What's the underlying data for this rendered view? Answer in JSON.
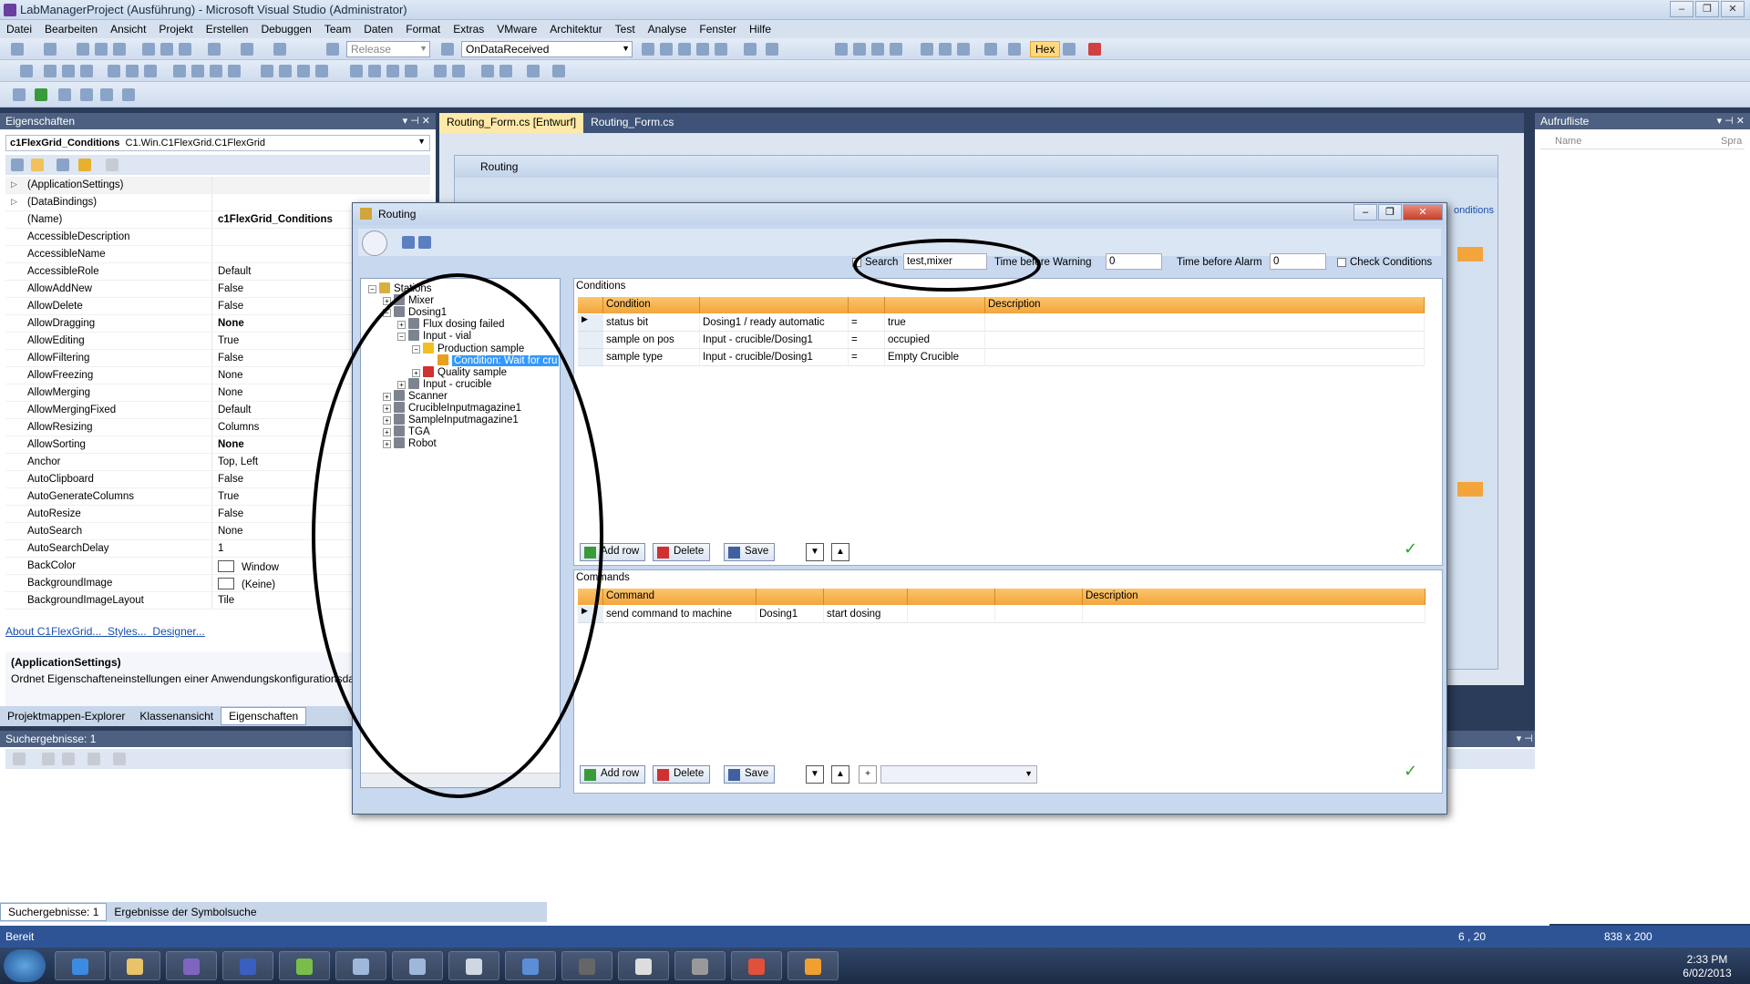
{
  "window": {
    "title": "LabManagerProject (Ausführung) - Microsoft Visual Studio (Administrator)"
  },
  "menu": [
    "Datei",
    "Bearbeiten",
    "Ansicht",
    "Projekt",
    "Erstellen",
    "Debuggen",
    "Team",
    "Daten",
    "Format",
    "Extras",
    "VMware",
    "Architektur",
    "Test",
    "Analyse",
    "Fenster",
    "Hilfe"
  ],
  "toolbar": {
    "config": "Release",
    "method": "OnDataReceived",
    "hex": "Hex"
  },
  "properties": {
    "title": "Eigenschaften",
    "object": "c1FlexGrid_Conditions",
    "type": "C1.Win.C1FlexGrid.C1FlexGrid",
    "rows": [
      {
        "name": "(ApplicationSettings)",
        "value": "",
        "expand": "▷"
      },
      {
        "name": "(DataBindings)",
        "value": "",
        "expand": "▷"
      },
      {
        "name": "(Name)",
        "value": "c1FlexGrid_Conditions",
        "bold": true
      },
      {
        "name": "AccessibleDescription",
        "value": ""
      },
      {
        "name": "AccessibleName",
        "value": ""
      },
      {
        "name": "AccessibleRole",
        "value": "Default"
      },
      {
        "name": "AllowAddNew",
        "value": "False"
      },
      {
        "name": "AllowDelete",
        "value": "False"
      },
      {
        "name": "AllowDragging",
        "value": "None",
        "bold": true
      },
      {
        "name": "AllowEditing",
        "value": "True"
      },
      {
        "name": "AllowFiltering",
        "value": "False"
      },
      {
        "name": "AllowFreezing",
        "value": "None"
      },
      {
        "name": "AllowMerging",
        "value": "None"
      },
      {
        "name": "AllowMergingFixed",
        "value": "Default"
      },
      {
        "name": "AllowResizing",
        "value": "Columns"
      },
      {
        "name": "AllowSorting",
        "value": "None",
        "bold": true
      },
      {
        "name": "Anchor",
        "value": "Top, Left"
      },
      {
        "name": "AutoClipboard",
        "value": "False"
      },
      {
        "name": "AutoGenerateColumns",
        "value": "True"
      },
      {
        "name": "AutoResize",
        "value": "False"
      },
      {
        "name": "AutoSearch",
        "value": "None"
      },
      {
        "name": "AutoSearchDelay",
        "value": "1"
      },
      {
        "name": "BackColor",
        "value": "Window",
        "swatch": true
      },
      {
        "name": "BackgroundImage",
        "value": "(Keine)",
        "swatch": true
      },
      {
        "name": "BackgroundImageLayout",
        "value": "Tile"
      }
    ],
    "links": [
      "About C1FlexGrid...",
      "Styles...",
      "Designer..."
    ],
    "desc_title": "(ApplicationSettings)",
    "desc_text": "Ordnet Eigenschafteneinstellungen einer Anwendungskonfigurationsdatei zu."
  },
  "left_tabs": [
    "Projektmappen-Explorer",
    "Klassenansicht",
    "Eigenschaften"
  ],
  "search": {
    "title": "Suchergebnisse: 1",
    "tabs": [
      "Suchergebnisse: 1",
      "Ergebnisse der Symbolsuche"
    ]
  },
  "doctabs": [
    "Routing_Form.cs [Entwurf]",
    "Routing_Form.cs"
  ],
  "aufruf": {
    "title": "Aufrufliste",
    "col1": "Name",
    "col2": "Spra"
  },
  "bgform": {
    "title": "Routing",
    "partial": "onditions"
  },
  "status": {
    "left": "Bereit",
    "pos": "6 , 20",
    "size": "838 x 200"
  },
  "clock": {
    "time": "2:33 PM",
    "date": "6/02/2013"
  },
  "routing": {
    "title": "Routing",
    "filter": {
      "search_label": "Search",
      "search_value": "test,mixer",
      "warning_label": "Time before Warning",
      "warning_value": "0",
      "alarm_label": "Time before Alarm",
      "alarm_value": "0",
      "check_label": "Check Conditions"
    },
    "tree": [
      {
        "label": "Stations",
        "level": 0
      },
      {
        "label": "Mixer",
        "level": 1
      },
      {
        "label": "Dosing1",
        "level": 1
      },
      {
        "label": "Flux dosing failed",
        "level": 2
      },
      {
        "label": "Input - vial",
        "level": 2
      },
      {
        "label": "Production sample",
        "level": 3
      },
      {
        "label": "Condition: Wait for cru",
        "level": 4,
        "selected": true
      },
      {
        "label": "Quality sample",
        "level": 3
      },
      {
        "label": "Input - crucible",
        "level": 2
      },
      {
        "label": "Scanner",
        "level": 1
      },
      {
        "label": "CrucibleInputmagazine1",
        "level": 1
      },
      {
        "label": "SampleInputmagazine1",
        "level": 1
      },
      {
        "label": "TGA",
        "level": 1
      },
      {
        "label": "Robot",
        "level": 1
      }
    ],
    "conditions": {
      "title": "Conditions",
      "headers": [
        "Condition",
        "",
        "",
        "",
        "Description"
      ],
      "rows": [
        [
          "status bit",
          "Dosing1 / ready automatic",
          "=",
          "true",
          ""
        ],
        [
          "sample on pos",
          "Input - crucible/Dosing1",
          "=",
          "occupied",
          ""
        ],
        [
          "sample type",
          "Input - crucible/Dosing1",
          "=",
          "Empty Crucible",
          ""
        ]
      ]
    },
    "commands": {
      "title": "Commands",
      "headers": [
        "Command",
        "",
        "",
        "",
        "",
        "Description"
      ],
      "rows": [
        [
          "send command to machine",
          "Dosing1",
          "start dosing",
          "",
          "",
          ""
        ]
      ]
    },
    "buttons": {
      "add": "Add row",
      "delete": "Delete",
      "save": "Save"
    }
  }
}
